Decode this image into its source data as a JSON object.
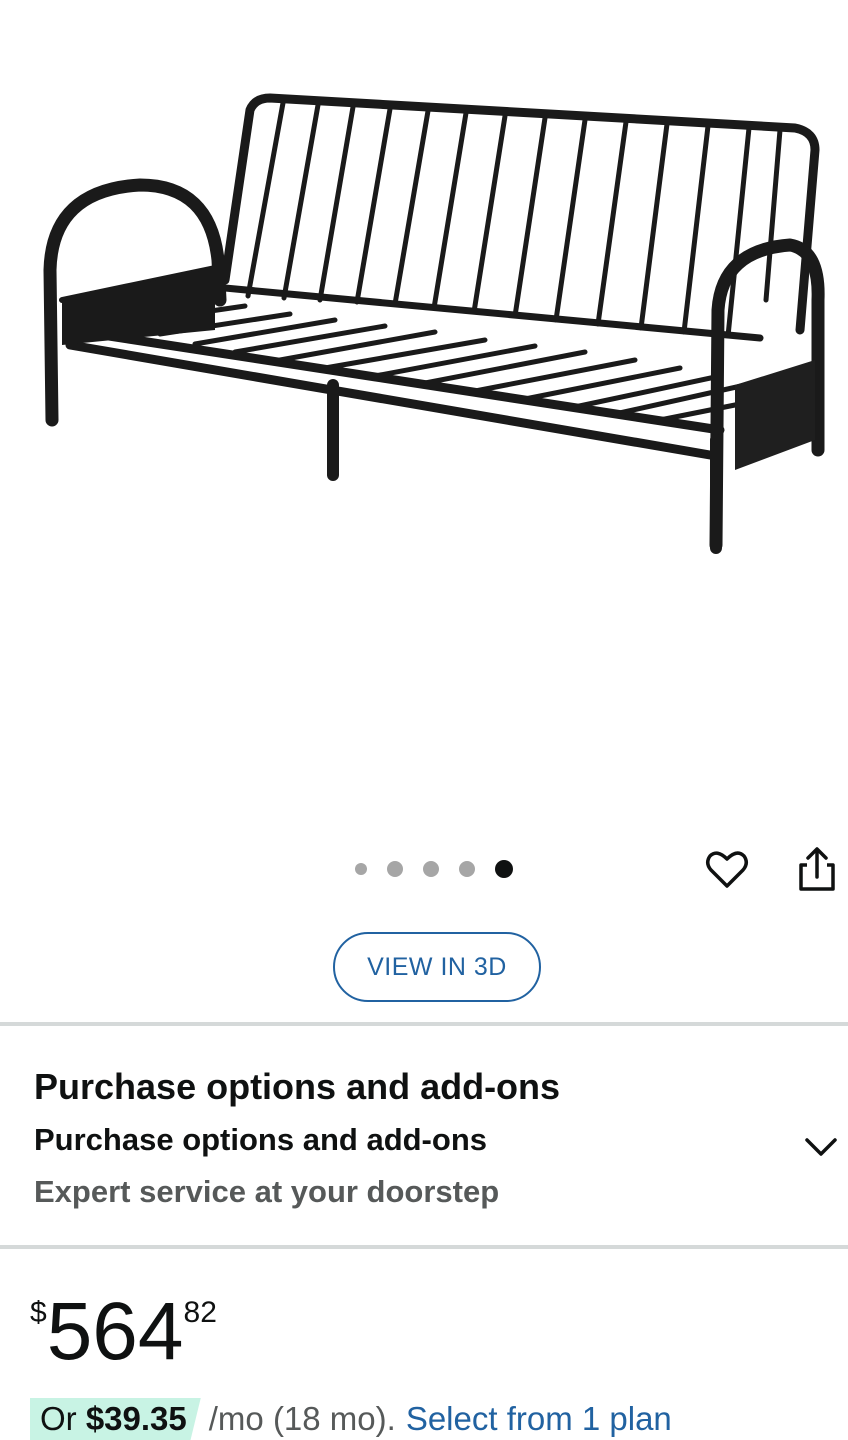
{
  "product_image": {
    "alt": "Black metal futon frame",
    "icon": "futon-frame-image"
  },
  "carousel": {
    "count": 5,
    "active_index": 4
  },
  "actions": {
    "favorite_icon": "heart-icon",
    "share_icon": "share-icon"
  },
  "view3d": {
    "label": "VIEW IN 3D"
  },
  "purchase_options": {
    "title": "Purchase options and add-ons",
    "subtitle": "Purchase options and add-ons",
    "note": "Expert service at your doorstep",
    "expand_icon": "chevron-down-icon"
  },
  "price": {
    "symbol": "$",
    "whole": "564",
    "fraction": "82"
  },
  "financing": {
    "prefix": "Or ",
    "amount": "$39.35",
    "term": "/mo (18 mo).",
    "link": "Select from 1 plan"
  },
  "colors": {
    "link_blue": "#2162a1",
    "text_dark": "#0f1111",
    "text_gray": "#565959",
    "divider": "#d5d9d9",
    "finance_highlight": "#c8f3e4"
  }
}
